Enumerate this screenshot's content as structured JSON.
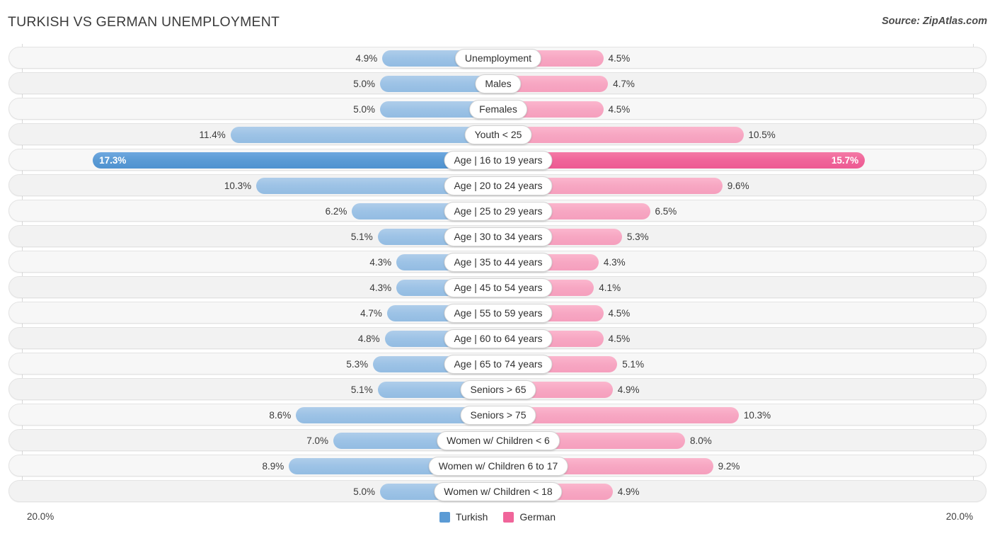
{
  "header": {
    "title": "TURKISH VS GERMAN UNEMPLOYMENT",
    "source": "Source: ZipAtlas.com"
  },
  "axis": {
    "left_max_label": "20.0%",
    "right_max_label": "20.0%",
    "max_value": 20.0
  },
  "legend": {
    "items": [
      {
        "label": "Turkish",
        "color": "#5b9bd5"
      },
      {
        "label": "German",
        "color": "#f0659a"
      }
    ]
  },
  "colors": {
    "turkish_light": "#9dc3e6",
    "turkish_dark": "#5b9bd5",
    "german_light": "#f7a7c3",
    "german_dark": "#f0659a",
    "row_track": "#f7f7f7",
    "gridline": "#d8d8d8"
  },
  "chart_data": {
    "type": "bar",
    "title": "TURKISH VS GERMAN UNEMPLOYMENT",
    "subtitle": "Source: ZipAtlas.com",
    "orientation": "horizontal-diverging",
    "xlabel": "",
    "ylabel": "",
    "xlim": [
      20.0,
      20.0
    ],
    "grid": true,
    "legend_position": "bottom-center",
    "categories": [
      "Unemployment",
      "Males",
      "Females",
      "Youth < 25",
      "Age | 16 to 19 years",
      "Age | 20 to 24 years",
      "Age | 25 to 29 years",
      "Age | 30 to 34 years",
      "Age | 35 to 44 years",
      "Age | 45 to 54 years",
      "Age | 55 to 59 years",
      "Age | 60 to 64 years",
      "Age | 65 to 74 years",
      "Seniors > 65",
      "Seniors > 75",
      "Women w/ Children < 6",
      "Women w/ Children 6 to 17",
      "Women w/ Children < 18"
    ],
    "series": [
      {
        "name": "Turkish",
        "color": "#9dc3e6",
        "values": [
          4.9,
          5.0,
          5.0,
          11.4,
          17.3,
          10.3,
          6.2,
          5.1,
          4.3,
          4.3,
          4.7,
          4.8,
          5.3,
          5.1,
          8.6,
          7.0,
          8.9,
          5.0
        ]
      },
      {
        "name": "German",
        "color": "#f7a7c3",
        "values": [
          4.5,
          4.7,
          4.5,
          10.5,
          15.7,
          9.6,
          6.5,
          5.3,
          4.3,
          4.1,
          4.5,
          4.5,
          5.1,
          4.9,
          10.3,
          8.0,
          9.2,
          4.9
        ]
      }
    ]
  },
  "rows": [
    {
      "label": "Unemployment",
      "left_value": "4.9%",
      "right_value": "4.5%",
      "left_num": 4.9,
      "right_num": 4.5,
      "highlight": false
    },
    {
      "label": "Males",
      "left_value": "5.0%",
      "right_value": "4.7%",
      "left_num": 5.0,
      "right_num": 4.7,
      "highlight": false
    },
    {
      "label": "Females",
      "left_value": "5.0%",
      "right_value": "4.5%",
      "left_num": 5.0,
      "right_num": 4.5,
      "highlight": false
    },
    {
      "label": "Youth < 25",
      "left_value": "11.4%",
      "right_value": "10.5%",
      "left_num": 11.4,
      "right_num": 10.5,
      "highlight": false
    },
    {
      "label": "Age | 16 to 19 years",
      "left_value": "17.3%",
      "right_value": "15.7%",
      "left_num": 17.3,
      "right_num": 15.7,
      "highlight": true
    },
    {
      "label": "Age | 20 to 24 years",
      "left_value": "10.3%",
      "right_value": "9.6%",
      "left_num": 10.3,
      "right_num": 9.6,
      "highlight": false
    },
    {
      "label": "Age | 25 to 29 years",
      "left_value": "6.2%",
      "right_value": "6.5%",
      "left_num": 6.2,
      "right_num": 6.5,
      "highlight": false
    },
    {
      "label": "Age | 30 to 34 years",
      "left_value": "5.1%",
      "right_value": "5.3%",
      "left_num": 5.1,
      "right_num": 5.3,
      "highlight": false
    },
    {
      "label": "Age | 35 to 44 years",
      "left_value": "4.3%",
      "right_value": "4.3%",
      "left_num": 4.3,
      "right_num": 4.3,
      "highlight": false
    },
    {
      "label": "Age | 45 to 54 years",
      "left_value": "4.3%",
      "right_value": "4.1%",
      "left_num": 4.3,
      "right_num": 4.1,
      "highlight": false
    },
    {
      "label": "Age | 55 to 59 years",
      "left_value": "4.7%",
      "right_value": "4.5%",
      "left_num": 4.7,
      "right_num": 4.5,
      "highlight": false
    },
    {
      "label": "Age | 60 to 64 years",
      "left_value": "4.8%",
      "right_value": "4.5%",
      "left_num": 4.8,
      "right_num": 4.5,
      "highlight": false
    },
    {
      "label": "Age | 65 to 74 years",
      "left_value": "5.3%",
      "right_value": "5.1%",
      "left_num": 5.3,
      "right_num": 5.1,
      "highlight": false
    },
    {
      "label": "Seniors > 65",
      "left_value": "5.1%",
      "right_value": "4.9%",
      "left_num": 5.1,
      "right_num": 4.9,
      "highlight": false
    },
    {
      "label": "Seniors > 75",
      "left_value": "8.6%",
      "right_value": "10.3%",
      "left_num": 8.6,
      "right_num": 10.3,
      "highlight": false
    },
    {
      "label": "Women w/ Children < 6",
      "left_value": "7.0%",
      "right_value": "8.0%",
      "left_num": 7.0,
      "right_num": 8.0,
      "highlight": false
    },
    {
      "label": "Women w/ Children 6 to 17",
      "left_value": "8.9%",
      "right_value": "9.2%",
      "left_num": 8.9,
      "right_num": 9.2,
      "highlight": false
    },
    {
      "label": "Women w/ Children < 18",
      "left_value": "5.0%",
      "right_value": "4.9%",
      "left_num": 5.0,
      "right_num": 4.9,
      "highlight": false
    }
  ]
}
